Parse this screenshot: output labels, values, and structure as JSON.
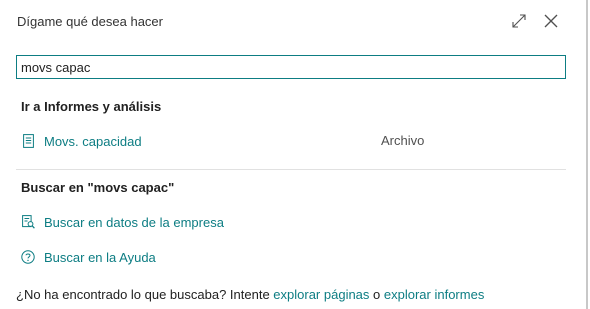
{
  "dialog": {
    "title": "Dígame qué desea hacer",
    "expand_icon": "expand-icon",
    "close_icon": "close-icon"
  },
  "search": {
    "value": "movs capac",
    "placeholder": ""
  },
  "section_reports": {
    "heading": "Ir a Informes y análisis",
    "items": [
      {
        "label": "Movs. capacidad",
        "category": "Archivo",
        "icon": "report-icon"
      }
    ]
  },
  "section_search": {
    "heading": "Buscar en \"movs capac\"",
    "items": [
      {
        "label": "Buscar en datos de la empresa",
        "icon": "data-search-icon"
      },
      {
        "label": "Buscar en la Ayuda",
        "icon": "help-icon"
      }
    ]
  },
  "footer": {
    "prefix": "¿No ha encontrado lo que buscaba? Intente ",
    "link_pages": "explorar páginas",
    "middle": " o ",
    "link_reports": "explorar informes"
  },
  "colors": {
    "accent": "#0d7d83",
    "text": "#212121",
    "divider": "#e1e1e1"
  }
}
